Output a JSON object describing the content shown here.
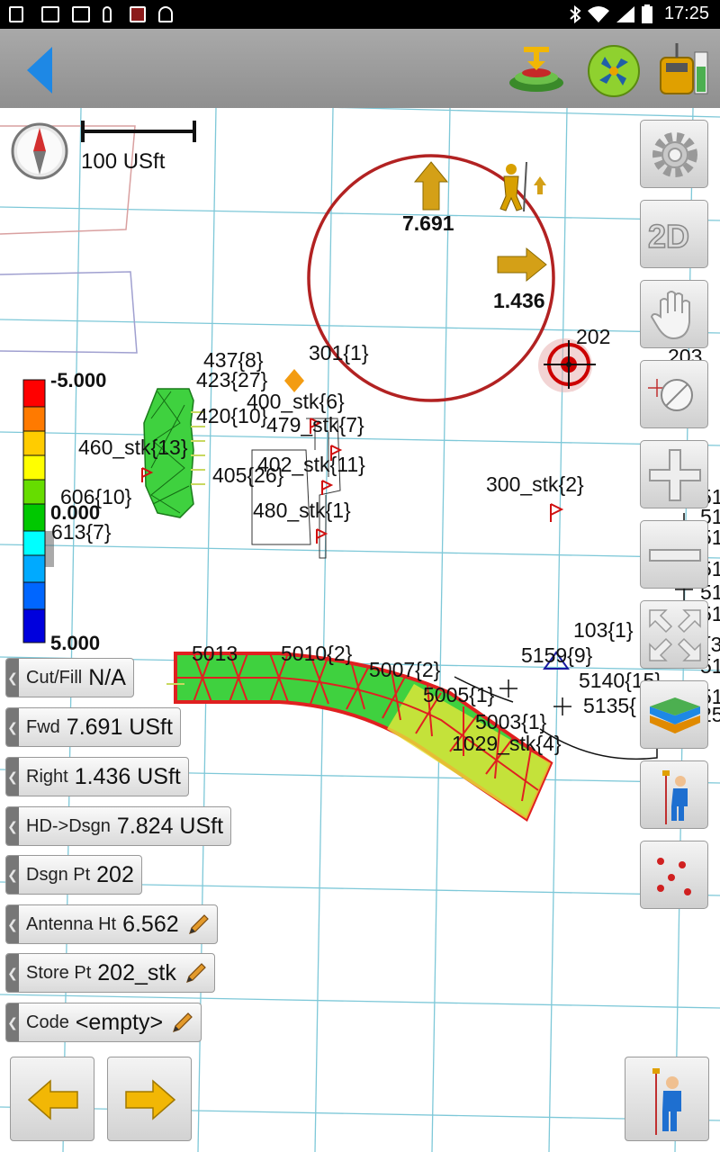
{
  "status_bar": {
    "time": "17:25"
  },
  "map": {
    "scale_label": "100 USft",
    "fwd_arrow_value": "7.691",
    "right_arrow_value": "1.436",
    "legend": {
      "top": "-5.000",
      "mid": "0.000",
      "bottom": "5.000"
    },
    "labels": {
      "p202": "202",
      "p203": "203",
      "p437": "437{8}",
      "p423": "423{27}",
      "p301": "301{1}",
      "p400": "400_stk{6}",
      "p420": "420{10}",
      "p479": "479_stk{7}",
      "p460": "460_stk{13}",
      "p402": "402_stk{11}",
      "p405": "405{26}",
      "p606": "606{10}",
      "p613": "613{7}",
      "p480": "480_stk{1}",
      "p300": "300_stk{2}",
      "p103": "103{1}",
      "p5013": "5013",
      "p5010": "5010{2}",
      "p5159": "5159{9}",
      "p5007": "5007{2}",
      "p5140": "5140{15}",
      "p5005": "5005{1}",
      "p5135": "5135{",
      "p5003": "5003{1}",
      "p1029": "1029_stk{4}",
      "e1": "51",
      "e2": "51",
      "e3": "51",
      "e4": "51",
      "e5": "51",
      "e6": "51",
      "e7": "{3",
      "e8": "51",
      "e9": "51",
      "e10": "25"
    }
  },
  "info_panel": {
    "cut_fill": {
      "label": "Cut/Fill",
      "value": "N/A"
    },
    "fwd": {
      "label": "Fwd",
      "value": "7.691 USft"
    },
    "right": {
      "label": "Right",
      "value": "1.436 USft"
    },
    "hd_dsgn": {
      "label": "HD->Dsgn",
      "value": "7.824 USft"
    },
    "dsgn_pt": {
      "label": "Dsgn Pt",
      "value": "202"
    },
    "antenna_ht": {
      "label": "Antenna Ht",
      "value": "6.562"
    },
    "store_pt": {
      "label": "Store Pt",
      "value": "202_stk"
    },
    "code": {
      "label": "Code",
      "value": "<empty>"
    }
  },
  "side_buttons": {
    "view_mode_label": "2D"
  },
  "colors": {
    "accent": "#1e88e5",
    "design_circle": "#b22222",
    "grid": "#7ec8d8",
    "arrow": "#d4a017"
  }
}
